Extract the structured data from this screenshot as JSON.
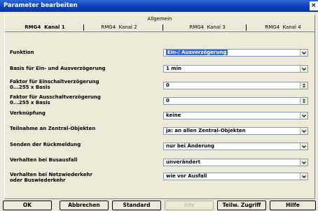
{
  "window": {
    "title": "Parameter bearbeiten",
    "close_glyph": "×"
  },
  "group": {
    "title": "Allgemein"
  },
  "tabs": [
    {
      "device": "RMG4",
      "channel": "Kanal 1",
      "active": true
    },
    {
      "device": "RMG4",
      "channel": "Kanal 2",
      "active": false
    },
    {
      "device": "RMG4",
      "channel": "Kanal 3",
      "active": false
    },
    {
      "device": "RMG4",
      "channel": "Kanal 4",
      "active": false
    }
  ],
  "params": [
    {
      "label": "Funktion",
      "value": "Ein-/ Ausverzögerung",
      "control": "dropdown",
      "selected": true
    },
    {
      "label": "Basis für Ein- und Ausverzögerung",
      "value": "1 min",
      "control": "dropdown"
    },
    {
      "label": "Faktor für Einschaltverzögerung\n0...255 x Basis",
      "value": "0",
      "control": "spinner"
    },
    {
      "label": "Faktor für Ausschaltverzögerung\n0...255 x Basis",
      "value": "0",
      "control": "spinner"
    },
    {
      "label": "Verknüpfung",
      "value": "keine",
      "control": "dropdown"
    },
    {
      "label": "Teilnahme an Zentral-Objekten",
      "value": "ja: an allen Zentral-Objekten",
      "control": "dropdown"
    },
    {
      "label": "Senden der Rückmeldung",
      "value": "nur bei Änderung",
      "control": "dropdown"
    },
    {
      "label": "Verhalten bei Busausfall",
      "value": "unverändert",
      "control": "dropdown"
    },
    {
      "label": "Verhalten bei Netzwiederkehr\noder Buswiederkehr",
      "value": "wie vor Ausfall",
      "control": "dropdown"
    }
  ],
  "buttons": {
    "ok": "OK",
    "cancel": "Abbrechen",
    "standard": "Standard",
    "info": "Info",
    "partial_access": "Teilw. Zugriff",
    "help": "Hilfe"
  },
  "colors": {
    "titlebar": "#0A3FB5",
    "selection": "#316AC5",
    "dialog_bg": "#ECE9D8"
  }
}
